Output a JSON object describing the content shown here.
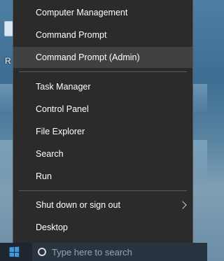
{
  "menu": {
    "items": [
      {
        "label": "Computer Management",
        "name": "menu-item-computer-management"
      },
      {
        "label": "Command Prompt",
        "name": "menu-item-command-prompt"
      },
      {
        "label": "Command Prompt (Admin)",
        "name": "menu-item-command-prompt-admin",
        "highlighted": true
      },
      {
        "label": "Task Manager",
        "name": "menu-item-task-manager"
      },
      {
        "label": "Control Panel",
        "name": "menu-item-control-panel"
      },
      {
        "label": "File Explorer",
        "name": "menu-item-file-explorer"
      },
      {
        "label": "Search",
        "name": "menu-item-search"
      },
      {
        "label": "Run",
        "name": "menu-item-run"
      },
      {
        "label": "Shut down or sign out",
        "name": "menu-item-shut-down-or-sign-out",
        "has_submenu": true
      },
      {
        "label": "Desktop",
        "name": "menu-item-desktop"
      }
    ]
  },
  "desktop": {
    "icon_label": "R"
  },
  "taskbar": {
    "search_placeholder": "Type here to search",
    "start_icon": "windows-logo-icon",
    "cortana_icon": "cortana-circle-icon"
  },
  "colors": {
    "menu_bg": "#2b2b2b",
    "menu_highlight": "#414141",
    "menu_text": "#ffffff",
    "taskbar_bg": "#1d2631",
    "start_accent": "#3c9be0"
  }
}
